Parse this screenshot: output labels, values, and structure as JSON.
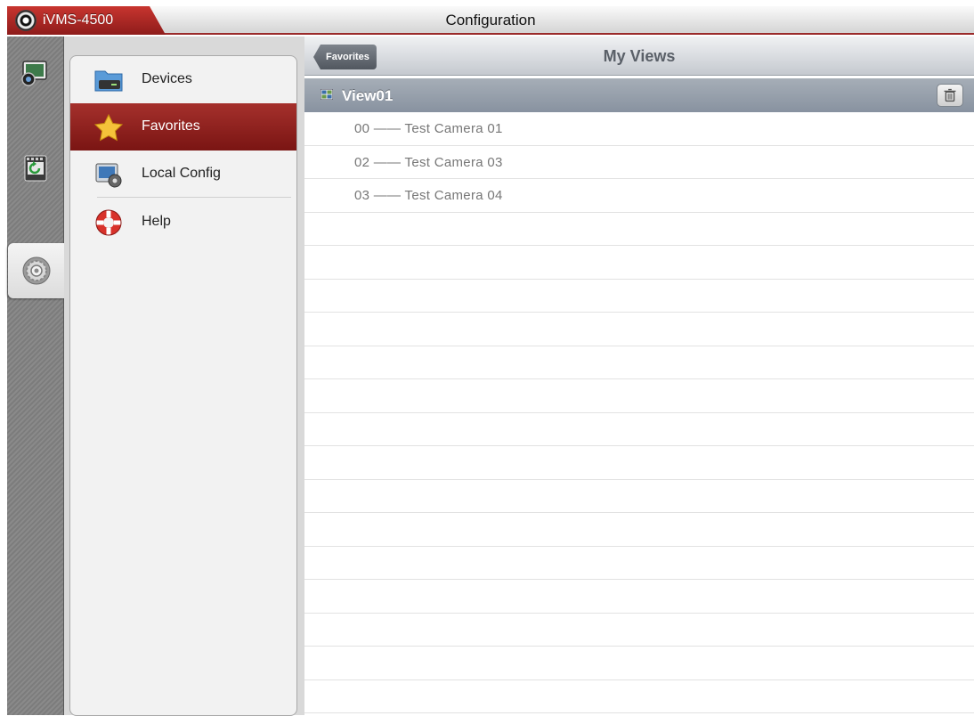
{
  "topbar": {
    "app_name": "iVMS-4500",
    "title": "Configuration",
    "app_icon": "camera-lens-icon"
  },
  "colors": {
    "brand_red": "#9a2a2a",
    "active_menu": "#8e1c1b",
    "section_header": "#8892a0"
  },
  "rail": {
    "items": [
      {
        "name": "live-view",
        "icon": "live-view-icon"
      },
      {
        "name": "playback",
        "icon": "playback-icon"
      },
      {
        "name": "configuration",
        "icon": "config-gear-icon",
        "active": true
      }
    ]
  },
  "menu": {
    "items": [
      {
        "label": "Devices",
        "icon": "devices-folder-icon"
      },
      {
        "label": "Favorites",
        "icon": "star-icon",
        "active": true
      },
      {
        "label": "Local Config",
        "icon": "local-config-icon"
      },
      {
        "label": "Help",
        "icon": "lifebuoy-icon"
      }
    ]
  },
  "main": {
    "back_label": "Favorites",
    "title": "My Views",
    "view": {
      "name": "View01",
      "icon": "view-grid-icon",
      "action_icon": "trash-icon"
    },
    "cameras": [
      "00  ——  Test  Camera 01",
      "02  ——  Test  Camera 03",
      "03  ——  Test  Camera 04"
    ]
  }
}
